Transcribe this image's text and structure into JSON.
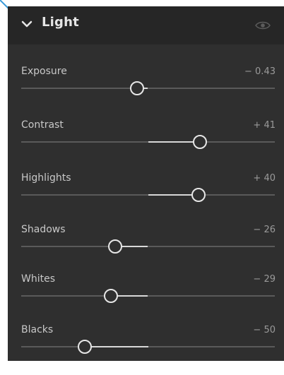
{
  "panel": {
    "title": "Light",
    "expand_icon": "chevron-down-icon",
    "visibility_icon": "eye-icon",
    "colors": {
      "background": "#2f2f2f",
      "header": "#262626",
      "track": "#5a5a5a",
      "fill": "#d8d8d8",
      "thumb": "#e6e6e6",
      "pointer": "#3a9ad9"
    }
  },
  "sliders": [
    {
      "label": "Exposure",
      "value": "− 0.43",
      "level": -0.43,
      "range": [
        -5,
        5
      ]
    },
    {
      "label": "Contrast",
      "value": "+ 41",
      "level": 41,
      "range": [
        -100,
        100
      ]
    },
    {
      "label": "Highlights",
      "value": "+ 40",
      "level": 40,
      "range": [
        -100,
        100
      ]
    },
    {
      "label": "Shadows",
      "value": "− 26",
      "level": -26,
      "range": [
        -100,
        100
      ]
    },
    {
      "label": "Whites",
      "value": "− 29",
      "level": -29,
      "range": [
        -100,
        100
      ]
    },
    {
      "label": "Blacks",
      "value": "− 50",
      "level": -50,
      "range": [
        -100,
        100
      ]
    }
  ]
}
